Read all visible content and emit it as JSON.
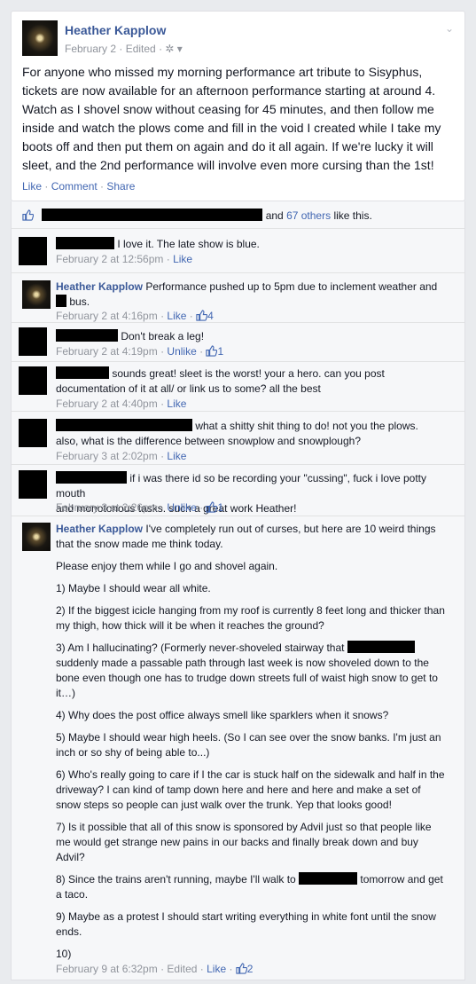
{
  "post": {
    "author": "Heather Kapplow",
    "date": "February 2",
    "edited": "Edited",
    "body": "For anyone who missed my morning performance art tribute to Sisyphus, tickets are now available for an afternoon performance starting at around 4. Watch as I shovel snow without ceasing for 45 minutes, and then follow me inside and watch the plows come and fill in the void I created while I take my boots off and then put them on again and do it all again. If we're lucky it will sleet, and the 2nd performance will involve even more cursing than the 1st!",
    "actions": {
      "like": "Like",
      "comment": "Comment",
      "share": "Share"
    }
  },
  "likes": {
    "and": "and",
    "others": "67 others",
    "suffix": "like this."
  },
  "comments": [
    {
      "text": "I love it. The late show is blue.",
      "date": "February 2 at 12:56pm",
      "action": "Like"
    },
    {
      "author": "Heather Kapplow",
      "text1": "Performance pushed up to 5pm due to inclement weather and",
      "text2": "bus.",
      "date": "February 2 at 4:16pm",
      "action": "Like",
      "likes": "4"
    },
    {
      "text": "Don't break a leg!",
      "date": "February 2 at 4:19pm",
      "action": "Unlike",
      "likes": "1"
    },
    {
      "text1": "sounds great! sleet is the worst! your a hero. can you post",
      "text2": "documentation of it at all/ or link us to some? all the best",
      "date": "February 2 at 4:40pm",
      "action": "Like"
    },
    {
      "text1": "what a shitty shit thing to do! not you the plows.",
      "text2": "also, what is the difference between snowplow and snowplough?",
      "date": "February 3 at 2:02pm",
      "action": "Like"
    },
    {
      "text1": "if i was there id so be recording your \"cussing\", fuck i love potty mouth",
      "text2": "and monotonous tasks. such a great work Heather!",
      "date": "February 3 at 2:26pm",
      "action": "Unlike",
      "likes": "1"
    },
    {
      "author": "Heather Kapplow",
      "intro": "I've completely run out of curses, but here are 10 weird things that the snow made me think today.",
      "p0": "Please enjoy them while I go and shovel again.",
      "p1": "1) Maybe I should wear all white.",
      "p2": "2) If the biggest icicle hanging from my roof is currently 8 feet long and thicker than my thigh, how thick will it be when it reaches the ground?",
      "p3a": "3) Am I hallucinating? (Formerly never-shoveled stairway that",
      "p3b": "suddenly made a passable path through last week is now shoveled down to the bone even though one has to trudge down streets full of waist high snow to get to it…)",
      "p4": "4) Why does the post office always smell like sparklers when it snows?",
      "p5": "5) Maybe I should wear high heels. (So I can see over the snow banks. I'm just an inch or so shy of being able to...)",
      "p6": "6) Who's really going to care if I the car is stuck half on the sidewalk and half in the driveway? I can kind of tamp down here and here and here and make a set of snow steps so people can just walk over the trunk. Yep that looks good!",
      "p7": "7) Is it possible that all of this snow is sponsored by Advil just so that people like me would get strange new pains in our backs and finally break down and buy Advil?",
      "p8a": "8) Since the trains aren't running, maybe I'll walk to",
      "p8b": "tomorrow and get a taco.",
      "p9": "9) Maybe as a protest I should start writing everything in white font until the snow ends.",
      "p10": "10)",
      "date": "February 9 at 6:32pm",
      "edited": "Edited",
      "action": "Like",
      "likes": "2"
    }
  ],
  "colors": {
    "link": "#4267b2",
    "name": "#3b5998",
    "meta": "#90949c"
  }
}
